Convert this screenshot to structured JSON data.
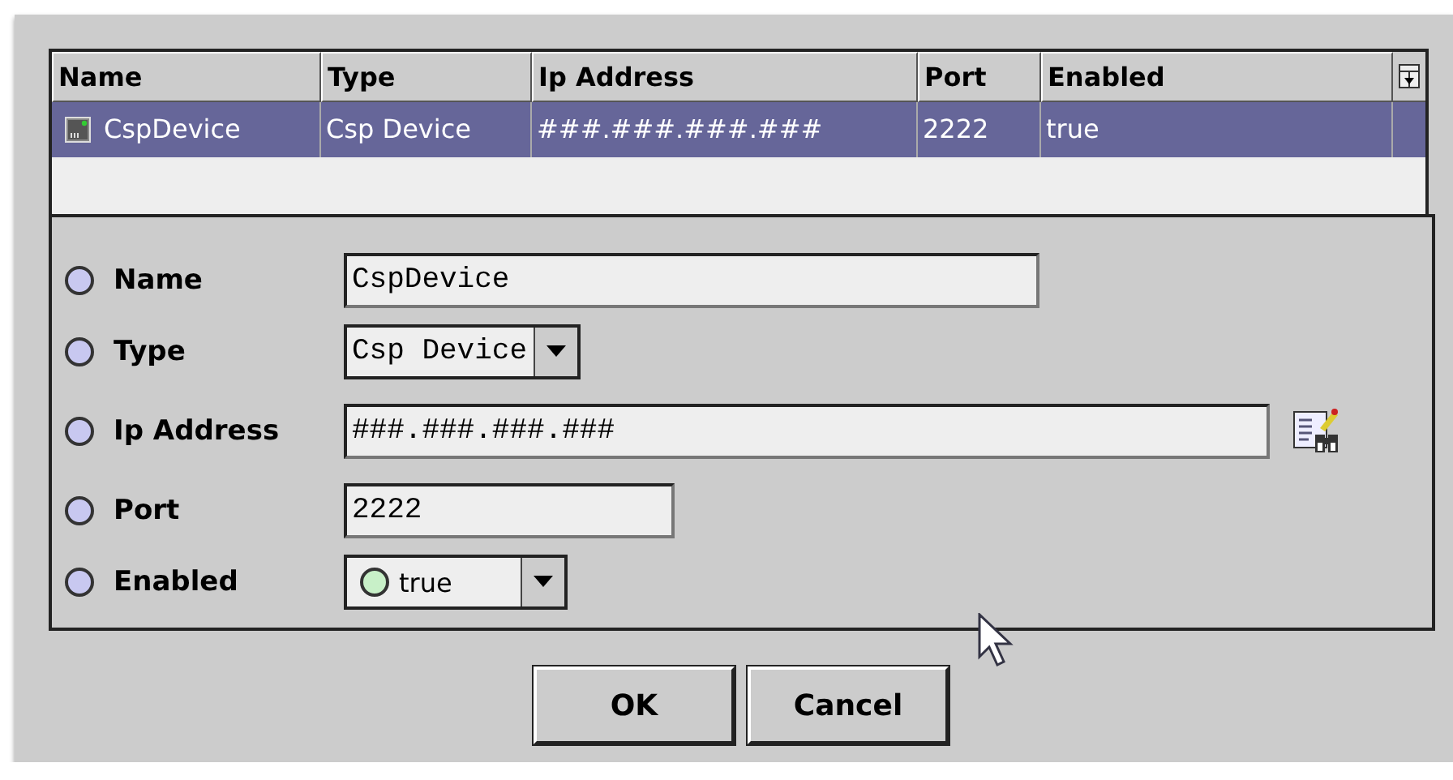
{
  "table": {
    "columns": [
      "Name",
      "Type",
      "Ip Address",
      "Port",
      "Enabled"
    ],
    "rows": [
      {
        "selected": true,
        "cells": [
          "CspDevice",
          "Csp Device",
          "###.###.###.###",
          "2222",
          "true"
        ]
      }
    ]
  },
  "form": {
    "fields": [
      {
        "label": "Name",
        "kind": "text",
        "value": "CspDevice",
        "selected": false
      },
      {
        "label": "Type",
        "kind": "select",
        "value": "Csp Device",
        "selected": false
      },
      {
        "label": "Ip Address",
        "kind": "lookup",
        "value": "###.###.###.###",
        "selected": false
      },
      {
        "label": "Port",
        "kind": "text",
        "value": "2222",
        "selected": false
      },
      {
        "label": "Enabled",
        "kind": "status-select",
        "value": "true",
        "selected": false
      }
    ]
  },
  "buttons": [
    "OK",
    "Cancel"
  ]
}
